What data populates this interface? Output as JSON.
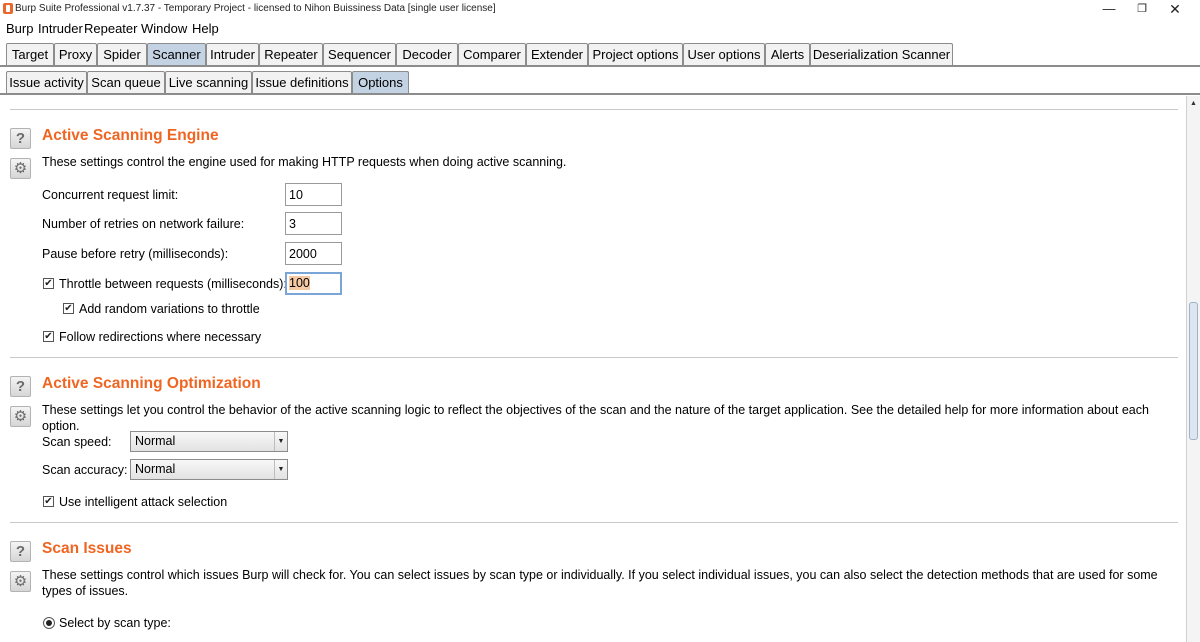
{
  "window": {
    "title": "Burp Suite Professional v1.7.37 - Temporary Project - licensed to Nihon Buissiness Data [single user license]",
    "minimize": "—",
    "maximize": "❐",
    "close": "✕"
  },
  "menu": [
    "Burp",
    "Intruder",
    "Repeater",
    "Window",
    "Help"
  ],
  "main_tabs": [
    "Target",
    "Proxy",
    "Spider",
    "Scanner",
    "Intruder",
    "Repeater",
    "Sequencer",
    "Decoder",
    "Comparer",
    "Extender",
    "Project options",
    "User options",
    "Alerts",
    "Deserialization Scanner"
  ],
  "main_tabs_active": "Scanner",
  "sub_tabs": [
    "Issue activity",
    "Scan queue",
    "Live scanning",
    "Issue definitions",
    "Options"
  ],
  "sub_tabs_active": "Options",
  "icons": {
    "help": "question-mark",
    "settings": "gear",
    "dropdown": "triangle-down",
    "scroll_up": "triangle-up"
  },
  "colors": {
    "section_title": "#f06522",
    "active_tab": "#c4d3e4",
    "selection": "#f6c9a5"
  },
  "sections": {
    "engine": {
      "title": "Active Scanning Engine",
      "description": "These settings control the engine used for making HTTP requests when doing active scanning.",
      "concurrent_label": "Concurrent request limit:",
      "concurrent_value": "10",
      "retries_label": "Number of retries on network failure:",
      "retries_value": "3",
      "pause_label": "Pause before retry (milliseconds):",
      "pause_value": "2000",
      "throttle_label": "Throttle between requests (milliseconds):",
      "throttle_checked": true,
      "throttle_value": "100",
      "random_label": "Add random variations to throttle",
      "random_checked": true,
      "follow_label": "Follow redirections where necessary",
      "follow_checked": true
    },
    "optimization": {
      "title": "Active Scanning Optimization",
      "description": "These settings let you control the behavior of the active scanning logic to reflect the objectives of the scan and the nature of the target application. See the detailed help for more information about each option.",
      "speed_label": "Scan speed:",
      "speed_value": "Normal",
      "accuracy_label": "Scan accuracy:",
      "accuracy_value": "Normal",
      "intelligent_label": "Use intelligent attack selection",
      "intelligent_checked": true
    },
    "issues": {
      "title": "Scan Issues",
      "description": "These settings control which issues Burp will check for. You can select issues by scan type or individually. If you select individual issues, you can also select the detection methods that are used for some types of issues.",
      "select_label": "Select by scan type:",
      "select_checked": true
    }
  }
}
